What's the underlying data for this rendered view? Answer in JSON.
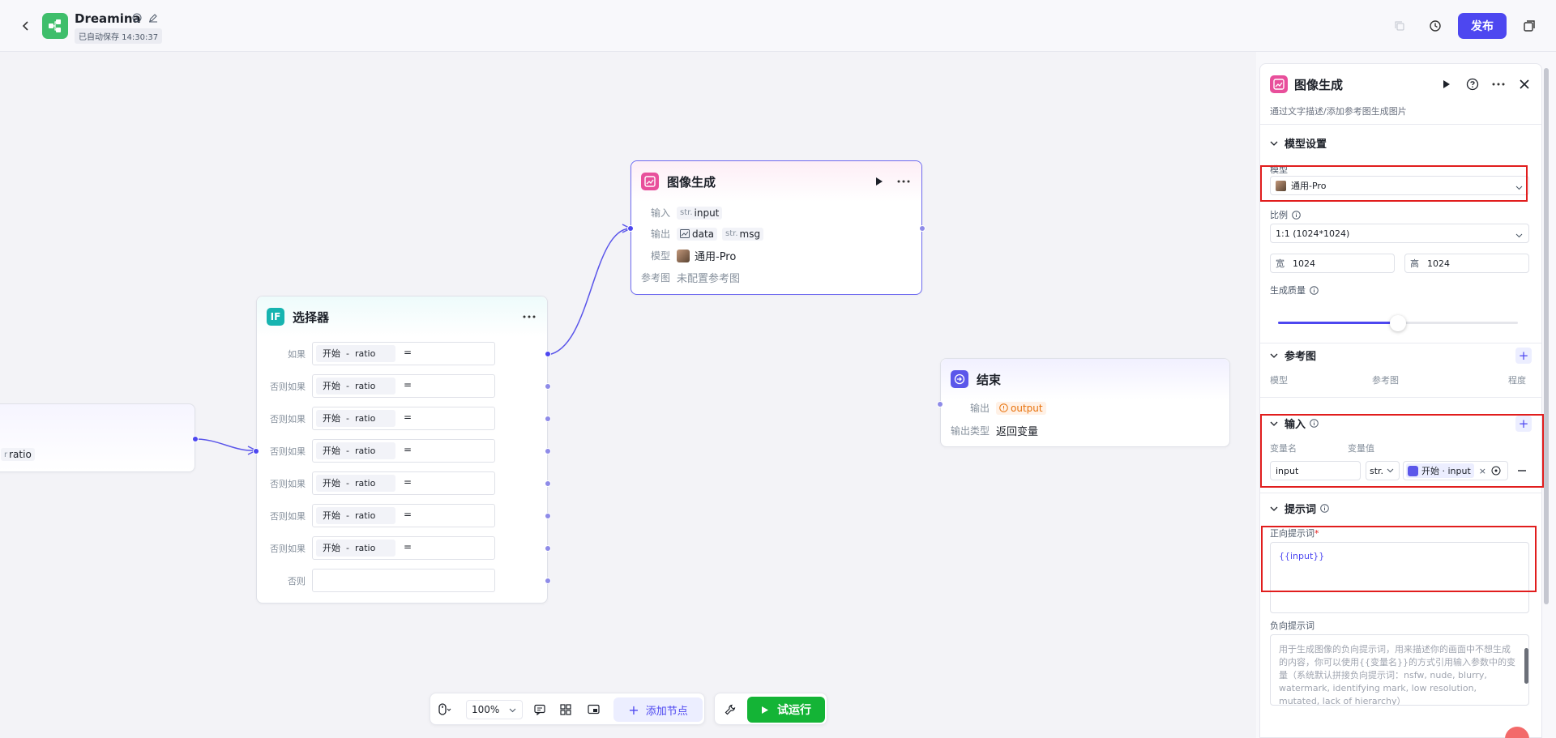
{
  "header": {
    "app_title": "Dreamina",
    "autosave": "已自动保存 14:30:37",
    "publish_label": "发布"
  },
  "nodes": {
    "start_partial": {
      "output_tag": "ratio"
    },
    "selector": {
      "title": "选择器",
      "conditions": [
        {
          "label": "如果",
          "chip": "开始  -  ratio",
          "op": "="
        },
        {
          "label": "否则如果",
          "chip": "开始  -  ratio",
          "op": "="
        },
        {
          "label": "否则如果",
          "chip": "开始  -  ratio",
          "op": "="
        },
        {
          "label": "否则如果",
          "chip": "开始  -  ratio",
          "op": "="
        },
        {
          "label": "否则如果",
          "chip": "开始  -  ratio",
          "op": "="
        },
        {
          "label": "否则如果",
          "chip": "开始  -  ratio",
          "op": "="
        },
        {
          "label": "否则如果",
          "chip": "开始  -  ratio",
          "op": "="
        }
      ],
      "else_label": "否则"
    },
    "image_gen": {
      "title": "图像生成",
      "input_label": "输入",
      "input_tag_pre": "str.",
      "input_tag": "input",
      "output_label": "输出",
      "output_tag1": "data",
      "output_tag2_pre": "str.",
      "output_tag2": "msg",
      "model_label": "模型",
      "model_value": "通用-Pro",
      "ref_label": "参考图",
      "ref_value": "未配置参考图"
    },
    "end": {
      "title": "结束",
      "output_label": "输出",
      "output_tag": "output",
      "type_label": "输出类型",
      "type_value": "返回变量"
    }
  },
  "panel": {
    "title": "图像生成",
    "description": "通过文字描述/添加参考图生成图片",
    "model_section": "模型设置",
    "model_label": "模型",
    "model_value": "通用-Pro",
    "ratio_label": "比例",
    "ratio_value": "1:1 (1024*1024)",
    "width_prefix": "宽",
    "width_value": "1024",
    "height_prefix": "高",
    "height_value": "1024",
    "quality_label": "生成质量",
    "quality_fraction": 0.5,
    "ref_section": "参考图",
    "ref_cols": [
      "模型",
      "参考图",
      "程度"
    ],
    "input_section": "输入",
    "var_name_col": "变量名",
    "var_value_col": "变量值",
    "var_name": "input",
    "var_type": "str.",
    "var_ref": "开始 · input",
    "prompt_section": "提示词",
    "positive_label": "正向提示词",
    "positive_value": "{{input}}",
    "negative_label": "负向提示词",
    "negative_placeholder": "用于生成图像的负向提示词，用来描述你的画面中不想生成的内容，你可以使用{{变量名}}的方式引用输入参数中的变量（系统默认拼接负向提示词：nsfw, nude, blurry, watermark, identifying mark, low resolution, mutated, lack of hierarchy）"
  },
  "toolbar": {
    "zoom": "100%",
    "add_node": "添加节点",
    "run": "试运行"
  }
}
